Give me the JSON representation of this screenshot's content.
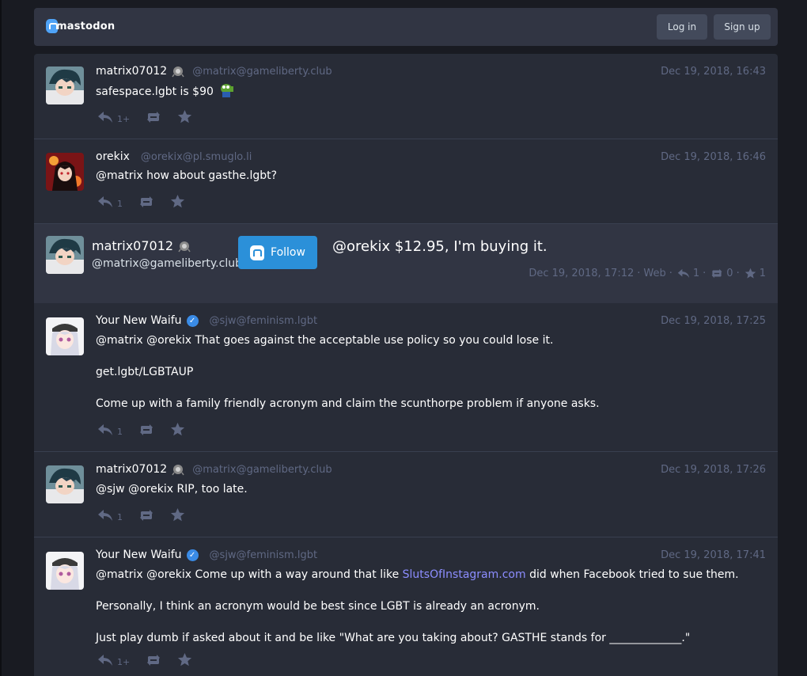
{
  "header": {
    "logo_text": "mastodon",
    "login_label": "Log in",
    "signup_label": "Sign up"
  },
  "statuses": [
    {
      "display_name": "matrix07012",
      "acct": "@matrix@gameliberty.club",
      "time": "Dec 19, 2018, 16:43",
      "content": "safespace.lgbt is $90",
      "reply_count": "1+"
    },
    {
      "display_name": "orekix",
      "acct": "@orekix@pl.smuglo.li",
      "time": "Dec 19, 2018, 16:46",
      "content": "@matrix how about gasthe.lgbt?",
      "reply_count": "1"
    },
    {
      "display_name": "Your New Waifu",
      "acct": "@sjw@feminism.lgbt",
      "time": "Dec 19, 2018, 17:25",
      "paragraphs": [
        "@matrix @orekix That goes against the acceptable use policy so you could lose it.",
        "get.lgbt/LGBTAUP",
        "Come up with a family friendly acronym and claim the scunthorpe problem if anyone asks."
      ],
      "reply_count": "1"
    },
    {
      "display_name": "matrix07012",
      "acct": "@matrix@gameliberty.club",
      "time": "Dec 19, 2018, 17:26",
      "content": "@sjw @orekix RIP, too late.",
      "reply_count": "1"
    },
    {
      "display_name": "Your New Waifu",
      "acct": "@sjw@feminism.lgbt",
      "time": "Dec 19, 2018, 17:41",
      "p1_before": "@matrix @orekix Come up with a way around that like ",
      "p1_link": "SlutsOfInstagram.com",
      "p1_after": " did when Facebook tried to sue them.",
      "p2": "Personally, I think an acronym would be best since LGBT is already an acronym.",
      "p3": "Just play dumb if asked about it and be like \"What are you taking about? GASTHE stands for _____________.\"",
      "reply_count": "1+"
    }
  ],
  "focal": {
    "display_name": "matrix07012",
    "acct": "@matrix@gameliberty.club",
    "follow_label": "Follow",
    "content": "@orekix $12.95, I'm buying it.",
    "meta_time": "Dec 19, 2018, 17:12",
    "meta_sep": "·",
    "meta_app": "Web",
    "reply_count": "1",
    "boost_count": "0",
    "fav_count": "1"
  },
  "colors": {
    "background": "#191b22",
    "panel": "#282c37",
    "focal_panel": "#313543",
    "accent": "#2b90d9",
    "muted": "#606984"
  }
}
